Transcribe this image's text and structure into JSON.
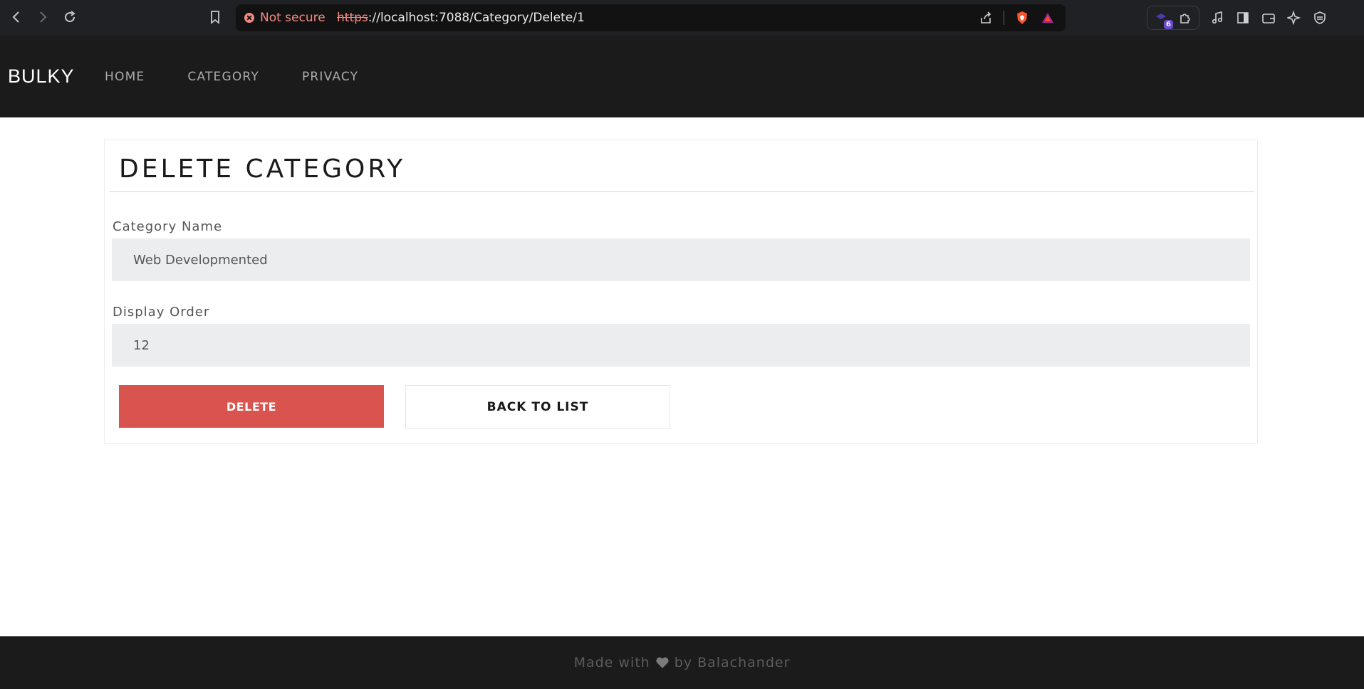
{
  "browser": {
    "security_label": "Not secure",
    "url_scheme": "https",
    "url_rest": "://localhost:7088/Category/Delete/1",
    "extension_badge": "6"
  },
  "site": {
    "brand": "BULKY",
    "nav": [
      "HOME",
      "CATEGORY",
      "PRIVACY"
    ]
  },
  "page": {
    "title": "DELETE CATEGORY",
    "fields": [
      {
        "label": "Category Name",
        "value": "Web Developmented"
      },
      {
        "label": "Display Order",
        "value": "12"
      }
    ],
    "delete_label": "DELETE",
    "back_label": "BACK TO LIST"
  },
  "footer": {
    "prefix": "Made with",
    "suffix": "by Balachander"
  },
  "colors": {
    "navbar_bg": "#1b1b1b",
    "danger": "#d9534f",
    "input_bg": "#ecedee"
  },
  "icons": [
    "back-arrow-icon",
    "forward-arrow-icon",
    "reload-icon",
    "bookmark-icon",
    "share-icon",
    "brave-shield-icon",
    "brave-rewards-icon",
    "extension-icon",
    "puzzle-icon",
    "music-icon",
    "sidebar-icon",
    "wallet-icon",
    "leo-ai-icon",
    "vpn-icon",
    "heart-icon"
  ]
}
